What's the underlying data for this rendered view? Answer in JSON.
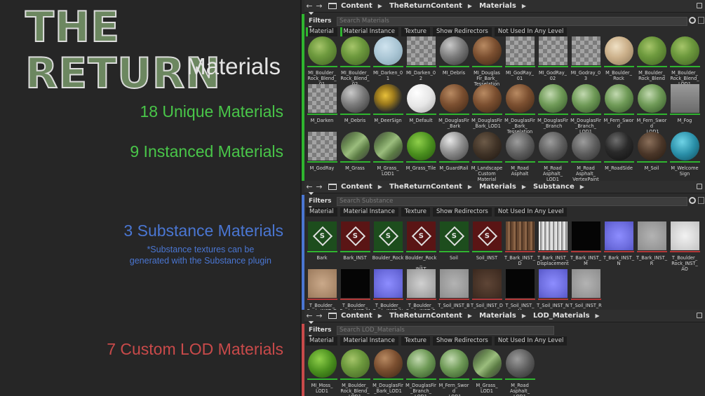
{
  "left": {
    "title": "THE RETURN",
    "subtitle": "Materials",
    "stat_unique": "18 Unique Materials",
    "stat_instanced": "9 Instanced Materials",
    "stat_substance": "3 Substance Materials",
    "note_line1": "*Substance textures can be",
    "note_line2": "generated with the Substance plugin",
    "stat_lod": "7 Custom LOD Materials",
    "colors": {
      "green": "#49c649",
      "blue": "#4a76d2",
      "red": "#c94a4a",
      "title": "#6c8760"
    }
  },
  "browsers": [
    {
      "path": [
        "Content",
        "TheReturnContent",
        "Materials"
      ],
      "filters_label": "Filters",
      "search_placeholder": "Search Materials",
      "chips": [
        "Material",
        "Material Instance",
        "Texture",
        "Show Redirectors",
        "Not Used In Any Level"
      ],
      "stripe_color": "#2fb52f",
      "assets": [
        {
          "label": "MI_Boulder_\nRock_Blend_\n01",
          "thumb": "moss",
          "bar": "green"
        },
        {
          "label": "MI_Boulder_\nRock_Blend_\n02",
          "thumb": "moss",
          "bar": "green"
        },
        {
          "label": "MI_Darken_01",
          "thumb": "pale-blue",
          "bar": "green"
        },
        {
          "label": "MI_Darken_02",
          "thumb": "checker",
          "bar": "green"
        },
        {
          "label": "MI_Debris",
          "thumb": "gray-sphere",
          "bar": "green"
        },
        {
          "label": "MI_Douglas\nFir_Bark_\nTesselation",
          "thumb": "bark",
          "bar": "green"
        },
        {
          "label": "MI_GodRay_\n01",
          "thumb": "checker",
          "bar": "green"
        },
        {
          "label": "MI_GodRay_\n02",
          "thumb": "checker",
          "bar": "green"
        },
        {
          "label": "MI_Godray_03",
          "thumb": "checker",
          "bar": "green"
        },
        {
          "label": "M_Boulder_\nRock",
          "thumb": "sand-rock",
          "bar": "green"
        },
        {
          "label": "M_Boulder_\nRock_Blend",
          "thumb": "moss",
          "bar": "green"
        },
        {
          "label": "M_Boulder_\nRock_Blend_\nLOD1",
          "thumb": "moss",
          "bar": "green"
        },
        {
          "label": "M_Darken",
          "thumb": "checker",
          "bar": "green"
        },
        {
          "label": "M_Debris",
          "thumb": "gray-sphere",
          "bar": "green"
        },
        {
          "label": "M_DeerSign",
          "thumb": "sign",
          "bar": "green"
        },
        {
          "label": "M_Default",
          "thumb": "white",
          "bar": "green"
        },
        {
          "label": "M_DouglasFir\n_Bark",
          "thumb": "bark",
          "bar": "green"
        },
        {
          "label": "M_DouglasFir\n_Bark_LOD1",
          "thumb": "bark",
          "bar": "green"
        },
        {
          "label": "M_DouglasFir\n_Bark_\nTesselation",
          "thumb": "bark",
          "bar": "green"
        },
        {
          "label": "M_DouglasFir\n_Branch",
          "thumb": "fern",
          "bar": "green"
        },
        {
          "label": "M_DouglasFir\n_Branch_\nLOD1",
          "thumb": "fern",
          "bar": "green"
        },
        {
          "label": "M_Fern_Sword",
          "thumb": "fern",
          "bar": "green"
        },
        {
          "label": "M_Fern_Sword\n_LOD1",
          "thumb": "fern",
          "bar": "green"
        },
        {
          "label": "M_Fog",
          "thumb": "fog",
          "bar": "green"
        },
        {
          "label": "M_GodRay",
          "thumb": "checker",
          "bar": "green"
        },
        {
          "label": "M_Grass",
          "thumb": "grass",
          "bar": "green"
        },
        {
          "label": "M_Grass_\nLOD1",
          "thumb": "grass",
          "bar": "green"
        },
        {
          "label": "M_Grass_Tile",
          "thumb": "green-sphere",
          "bar": "green"
        },
        {
          "label": "M_GuardRail",
          "thumb": "metal",
          "bar": "green"
        },
        {
          "label": "M_Landscape\nCustom\nMaterial",
          "thumb": "dirt",
          "bar": "green"
        },
        {
          "label": "M_Road\nAsphalt",
          "thumb": "road",
          "bar": "green"
        },
        {
          "label": "M_Road\nAsphalt_\nLOD1",
          "thumb": "road",
          "bar": "green"
        },
        {
          "label": "M_Road\nAsphalt_\nVertexPaint",
          "thumb": "road",
          "bar": "green"
        },
        {
          "label": "M_RoadSide",
          "thumb": "dark-sphere",
          "bar": "green"
        },
        {
          "label": "M_Soil",
          "thumb": "soil",
          "bar": "green"
        },
        {
          "label": "M_Welcome\nSign",
          "thumb": "teal",
          "bar": "green"
        }
      ]
    },
    {
      "path": [
        "Content",
        "TheReturnContent",
        "Materials",
        "Substance"
      ],
      "filters_label": "Filters",
      "search_placeholder": "Search Substance",
      "chips": [
        "Material",
        "Material Instance",
        "Texture",
        "Show Redirectors",
        "Not Used In Any Level"
      ],
      "stripe_color": "#4a76d2",
      "assets": [
        {
          "label": "Bark",
          "thumb": "subs-green",
          "bar": "green"
        },
        {
          "label": "Bark_INST",
          "thumb": "subs-red",
          "bar": "green"
        },
        {
          "label": "Boulder_Rock",
          "thumb": "subs-green",
          "bar": "green"
        },
        {
          "label": "Boulder_Rock_\nINST",
          "thumb": "subs-red",
          "bar": "green"
        },
        {
          "label": "Soil",
          "thumb": "subs-green",
          "bar": "green"
        },
        {
          "label": "Soil_INST",
          "thumb": "subs-red",
          "bar": "green"
        },
        {
          "label": "T_Bark_INST_\nD",
          "thumb": "tex-bark",
          "bar": "red"
        },
        {
          "label": "T_Bark_INST_\nDisplacement",
          "thumb": "tex-bark-disp",
          "bar": "red"
        },
        {
          "label": "T_Bark_INST_\nM",
          "thumb": "tex-black",
          "bar": "red"
        },
        {
          "label": "T_Bark_INST_\nN",
          "thumb": "tex-normal",
          "bar": "red"
        },
        {
          "label": "T_Bark_INST_\nR",
          "thumb": "tex-gray",
          "bar": "red"
        },
        {
          "label": "T_Boulder_\nRock_INST_\nAO",
          "thumb": "tex-ao",
          "bar": "red"
        },
        {
          "label": "T_Boulder_\nRock_INST_D",
          "thumb": "tex-sand",
          "bar": "red"
        },
        {
          "label": "T_Boulder_\nRock_INST_M",
          "thumb": "tex-black",
          "bar": "red"
        },
        {
          "label": "T_Boulder_\nRock_INST_N",
          "thumb": "tex-normal",
          "bar": "red"
        },
        {
          "label": "T_Boulder_\nRock_INST_R",
          "thumb": "tex-cloud",
          "bar": "red"
        },
        {
          "label": "T_Soil_INST_B",
          "thumb": "tex-gray",
          "bar": "red"
        },
        {
          "label": "T_Soil_INST_D",
          "thumb": "tex-soil",
          "bar": "red"
        },
        {
          "label": "T_Soil_INST_\nM",
          "thumb": "tex-black",
          "bar": "red"
        },
        {
          "label": "T_Soil_INST_N",
          "thumb": "tex-normal",
          "bar": "red"
        },
        {
          "label": "T_Soil_INST_R",
          "thumb": "tex-gray",
          "bar": "red"
        }
      ]
    },
    {
      "path": [
        "Content",
        "TheReturnContent",
        "Materials",
        "LOD_Materials"
      ],
      "filters_label": "Filters",
      "search_placeholder": "Search LOD_Materials",
      "chips": [
        "Material",
        "Material Instance",
        "Texture",
        "Show Redirectors",
        "Not Used In Any Level"
      ],
      "stripe_color": "#c94a4a",
      "assets": [
        {
          "label": "MI_Moss_\nLOD1",
          "thumb": "green-sphere",
          "bar": "green"
        },
        {
          "label": "M_Boulder_\nRock_Blend_\nLOD1",
          "thumb": "moss",
          "bar": "green"
        },
        {
          "label": "M_DouglasFir\n_Bark_LOD1",
          "thumb": "bark",
          "bar": "green"
        },
        {
          "label": "M_DouglasFir\n_Branch_\nLOD1",
          "thumb": "fern",
          "bar": "green"
        },
        {
          "label": "M_Fern_Sword\n_LOD1",
          "thumb": "fern",
          "bar": "green"
        },
        {
          "label": "M_Grass_\nLOD1",
          "thumb": "grass",
          "bar": "green"
        },
        {
          "label": "M_Road\nAsphalt_\nLOD1",
          "thumb": "road",
          "bar": "green"
        }
      ]
    }
  ]
}
